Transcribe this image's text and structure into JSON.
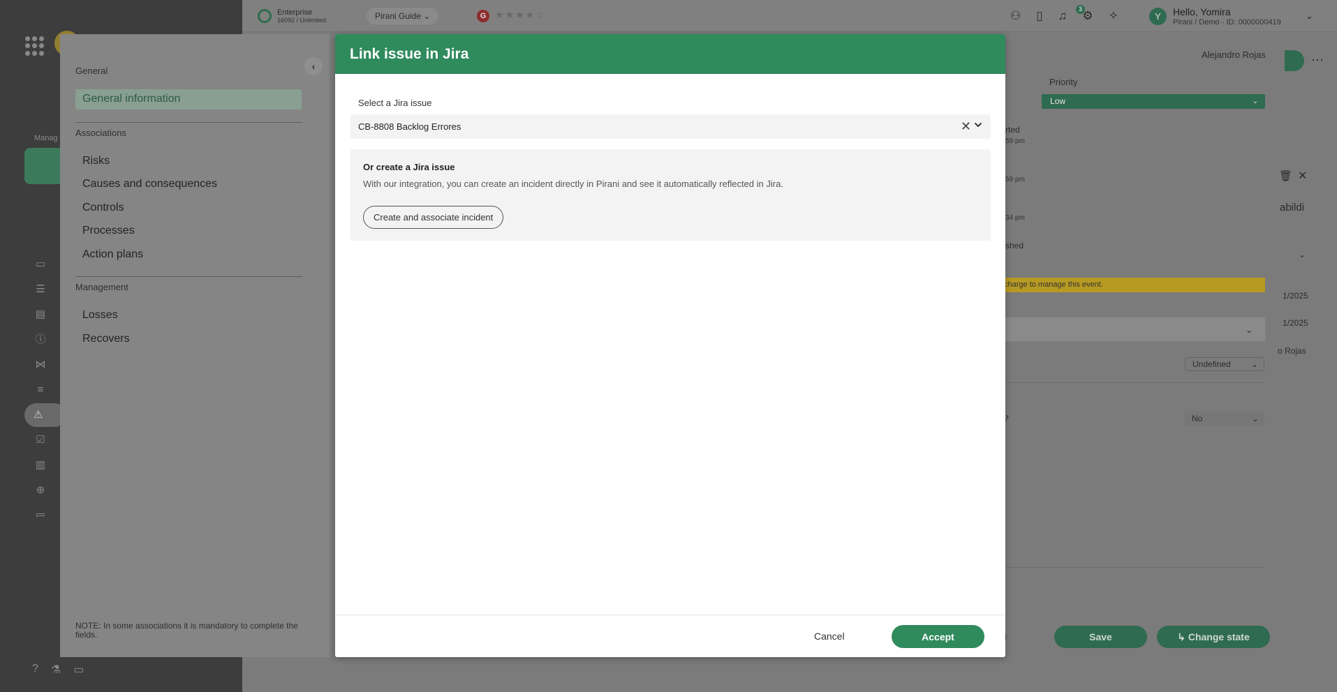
{
  "topbar": {
    "plan_name": "Enterprise",
    "plan_usage": "16092 / Unlimited",
    "guide_label": "Pirani Guide",
    "rating_logo": "G",
    "rating_stars": "★★★★☆",
    "notifications_count": "3",
    "avatar_initial": "Y",
    "greeting": "Hello, Yomira",
    "user_subtitle": "Pirani / Demo - ID: 0000000419"
  },
  "left_rail": {
    "section_label": "Manag"
  },
  "associations": {
    "sections": [
      {
        "label": "General",
        "items": [
          "General information"
        ]
      },
      {
        "label": "Associations",
        "items": [
          "Risks",
          "Causes and consequences",
          "Controls",
          "Processes",
          "Action plans"
        ]
      },
      {
        "label": "Management",
        "items": [
          "Losses",
          "Recovers"
        ]
      }
    ],
    "active_item": "General information",
    "note": "NOTE: In some associations it is mandatory to complete the fields."
  },
  "background_detail": {
    "assignee": "Alejandro Rojas",
    "priority_label": "Priority",
    "priority_value": "Low",
    "status_started": "rted",
    "time_1": "59 pm",
    "time_2": "59 pm",
    "time_3": "34 pm",
    "status_finished": "shed",
    "partial_title": "abildi",
    "warning_fragment": "charge to manage this event.",
    "date_1": "1/2025",
    "date_2": "1/2025",
    "person_fragment": "o Rojas",
    "undefined_value": "Undefined",
    "question_fragment": "?",
    "no_value": "No",
    "cancel_fragment": "el",
    "save_label": "Save",
    "change_state_label": "Change state"
  },
  "modal": {
    "title": "Link issue in Jira",
    "select_label": "Select a Jira issue",
    "selected_issue": "CB-8808 Backlog Errores",
    "create_title": "Or create a Jira issue",
    "create_description": "With our integration, you can create an incident directly in Pirani and see it automatically reflected in Jira.",
    "create_button": "Create and associate incident",
    "cancel_label": "Cancel",
    "accept_label": "Accept"
  },
  "colors": {
    "primary": "#2f8a5c",
    "header_text": "#ffffff",
    "input_bg": "#f3f3f3"
  }
}
